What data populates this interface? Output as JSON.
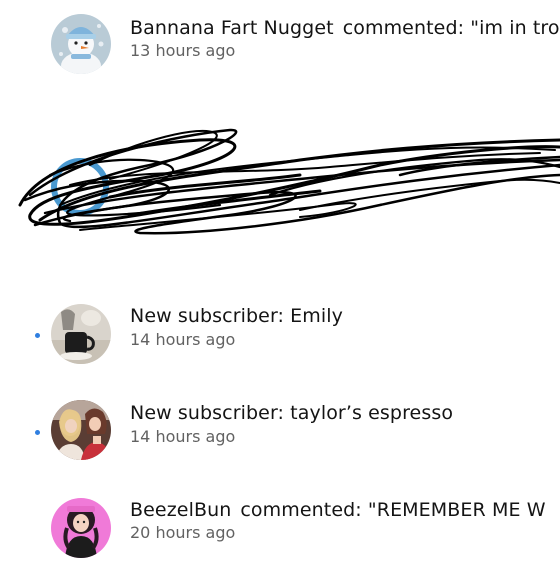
{
  "notifications": [
    {
      "author": "Bannana Fart Nugget",
      "text": "commented: \"im in tro",
      "time": "13 hours ago",
      "unread": false,
      "avatar_icon": "snowman-avatar"
    },
    {
      "title": "New subscriber: Emily",
      "time": "14 hours ago",
      "unread": true,
      "avatar_icon": "coffee-cup-avatar"
    },
    {
      "title": "New subscriber: taylor’s espresso",
      "time": "14 hours ago",
      "unread": true,
      "avatar_icon": "two-people-avatar"
    },
    {
      "author": "BeezelBun",
      "text": "commented: \"REMEMBER ME W",
      "time": "20 hours ago",
      "unread": false,
      "avatar_icon": "pink-avatar"
    }
  ],
  "colors": {
    "unread_dot": "#2f7fe0",
    "title_text": "#141414",
    "time_text": "#626262",
    "scribble": "#000000"
  }
}
